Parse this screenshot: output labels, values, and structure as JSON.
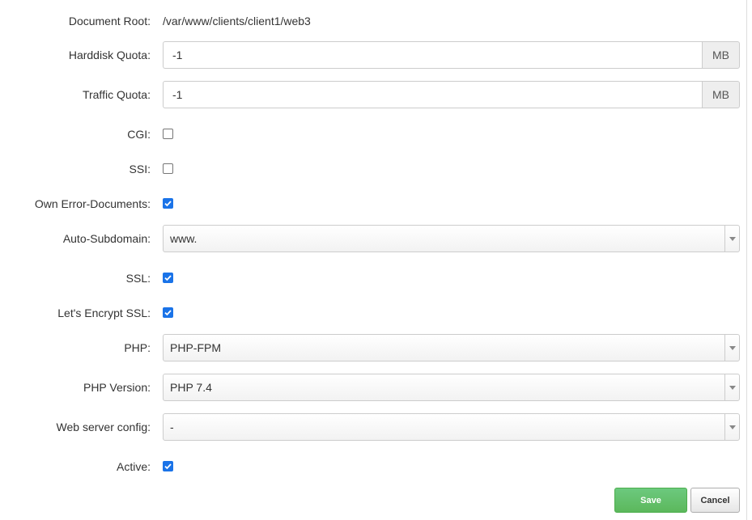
{
  "form": {
    "document_root": {
      "label": "Document Root:",
      "value": "/var/www/clients/client1/web3"
    },
    "harddisk_quota": {
      "label": "Harddisk Quota:",
      "value": "-1",
      "unit": "MB"
    },
    "traffic_quota": {
      "label": "Traffic Quota:",
      "value": "-1",
      "unit": "MB"
    },
    "cgi": {
      "label": "CGI:",
      "checked": false
    },
    "ssi": {
      "label": "SSI:",
      "checked": false
    },
    "own_error_documents": {
      "label": "Own Error-Documents:",
      "checked": true
    },
    "auto_subdomain": {
      "label": "Auto-Subdomain:",
      "value": "www."
    },
    "ssl": {
      "label": "SSL:",
      "checked": true
    },
    "lets_encrypt_ssl": {
      "label": "Let's Encrypt SSL:",
      "checked": true
    },
    "php": {
      "label": "PHP:",
      "value": "PHP-FPM"
    },
    "php_version": {
      "label": "PHP Version:",
      "value": "PHP 7.4"
    },
    "web_server_config": {
      "label": "Web server config:",
      "value": "-"
    },
    "active": {
      "label": "Active:",
      "checked": true
    }
  },
  "buttons": {
    "save": "Save",
    "cancel": "Cancel"
  },
  "colors": {
    "checkbox_checked": "#1a73e8",
    "save_button": "#5cb85c",
    "addon_background": "#eeeeee"
  }
}
